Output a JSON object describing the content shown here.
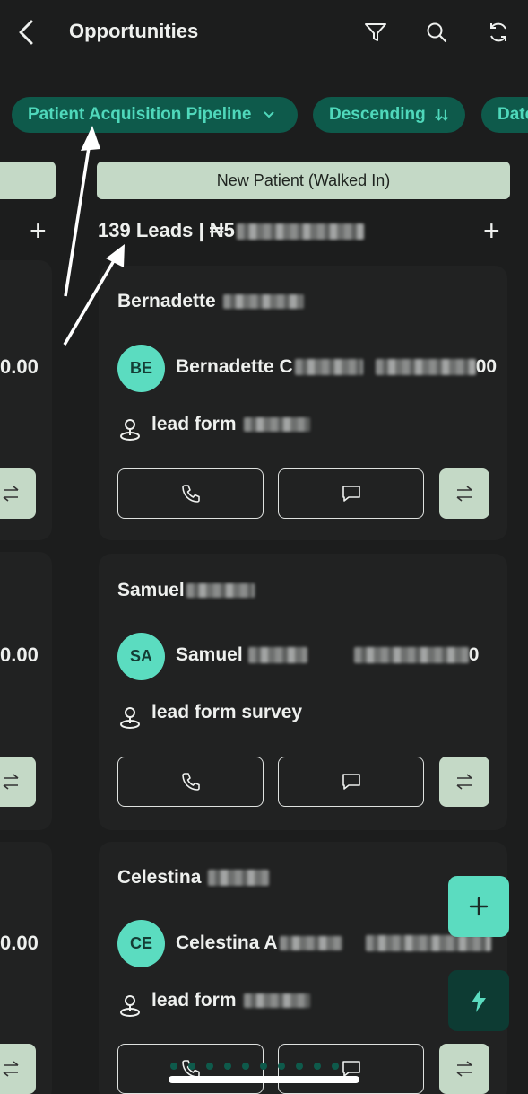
{
  "header": {
    "title": "Opportunities",
    "icons": [
      "back-icon",
      "filter-icon",
      "search-icon",
      "refresh-icon"
    ]
  },
  "chips": [
    {
      "label": "Patient Acquisition Pipeline",
      "icon": "chevron-down-icon"
    },
    {
      "label": "Descending",
      "icon": "sort-descending-icon"
    },
    {
      "label": "Date"
    }
  ],
  "stage": {
    "name": "New Patient (Walked In)",
    "leads_count": "139 Leads | ₦5"
  },
  "left_column": {
    "amount": "0.00"
  },
  "cards": [
    {
      "title": "Bernadette",
      "avatar_initials": "BE",
      "contact_name": "Bernadette C",
      "contact_value_suffix": "00",
      "source": "lead form"
    },
    {
      "title": "Samuel",
      "avatar_initials": "SA",
      "contact_name": "Samuel",
      "contact_value_suffix": "0",
      "source": "lead form survey"
    },
    {
      "title": "Celestina",
      "avatar_initials": "CE",
      "contact_name": "Celestina A",
      "contact_value_suffix": "",
      "source": "lead form"
    }
  ],
  "colors": {
    "background": "#1c1d1d",
    "chip_bg": "#0e5a4b",
    "chip_text": "#4fd8bb",
    "stage_bg": "#c4d9c6",
    "avatar_bg": "#5bdcc0"
  }
}
